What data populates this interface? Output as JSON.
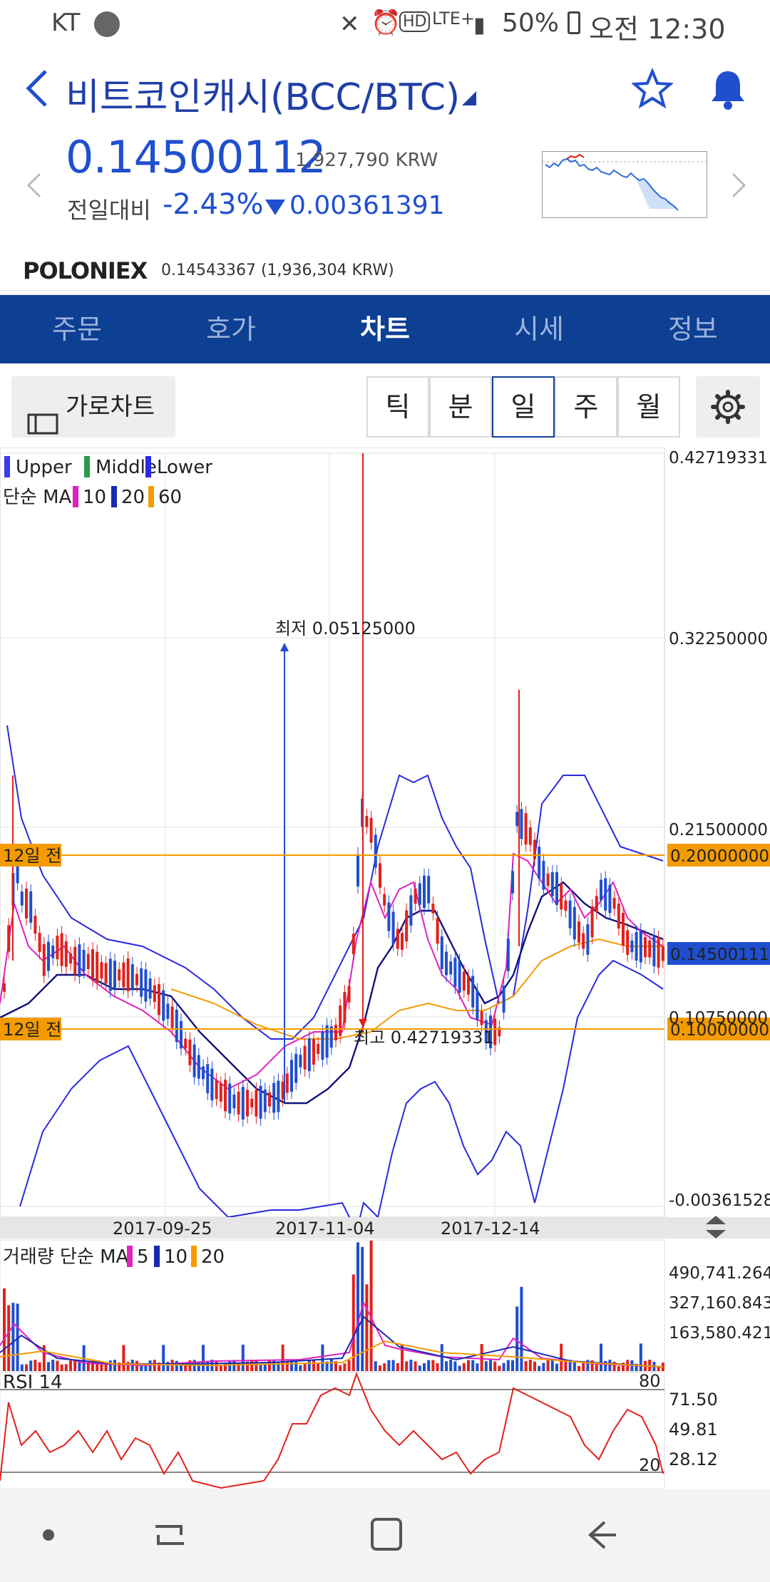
{
  "status": {
    "carrier": "KT",
    "battery": "50%",
    "time": "오전 12:30",
    "network": "LTE+"
  },
  "header": {
    "title": "비트코인캐시(BCC/BTC)",
    "price": "0.14500112",
    "price_krw": "1,927,790 KRW",
    "change_label": "전일대비",
    "change_pct": "-2.43%",
    "change_abs": "0.00361391"
  },
  "exchange": {
    "name": "POLONIEX",
    "price": "0.14543367 (1,936,304 KRW)"
  },
  "tabs": [
    "주문",
    "호가",
    "차트",
    "시세",
    "정보"
  ],
  "active_tab": 2,
  "toolbar": {
    "landscape_label": "가로차트",
    "periods": [
      "틱",
      "분",
      "일",
      "주",
      "월"
    ],
    "active_period": 2
  },
  "colors": {
    "blue": "#1f4fcf",
    "red": "#e3201b",
    "navy": "#0d3f93",
    "orange": "#f39b00",
    "magenta": "#e020c0"
  },
  "chart_data": {
    "main": {
      "type": "candlestick",
      "legend_bb": [
        "Upper",
        "Middle",
        "Lower"
      ],
      "legend_ma": {
        "label": "단순 MA",
        "periods": [
          "10",
          "20",
          "60"
        ]
      },
      "y_ticks": [
        "0.42719331",
        "0.32250000",
        "0.21500000",
        "0.10750000",
        "-0.00361528"
      ],
      "ylim": [
        -0.00361528,
        0.42719331
      ],
      "x_ticks": [
        "2017-09-25",
        "2017-11-04",
        "2017-12-14"
      ],
      "price_lines": [
        {
          "label": "12일 전",
          "value": "0.20000000"
        },
        {
          "label": "12일 전",
          "value": "0.10000000"
        }
      ],
      "current_price_label": "0.14500111",
      "annotation_low": "최저 0.05125000",
      "annotation_high": "최고 0.42719331"
    },
    "volume": {
      "type": "bar",
      "legend": {
        "label": "거래량 단순 MA",
        "periods": [
          "5",
          "10",
          "20"
        ]
      },
      "y_ticks": [
        "490,741.264",
        "327,160.843",
        "163,580.421"
      ]
    },
    "rsi": {
      "type": "line",
      "label": "RSI 14",
      "upper": "80",
      "lower": "20",
      "y_ticks": [
        "71.50",
        "49.81",
        "28.12"
      ]
    }
  }
}
